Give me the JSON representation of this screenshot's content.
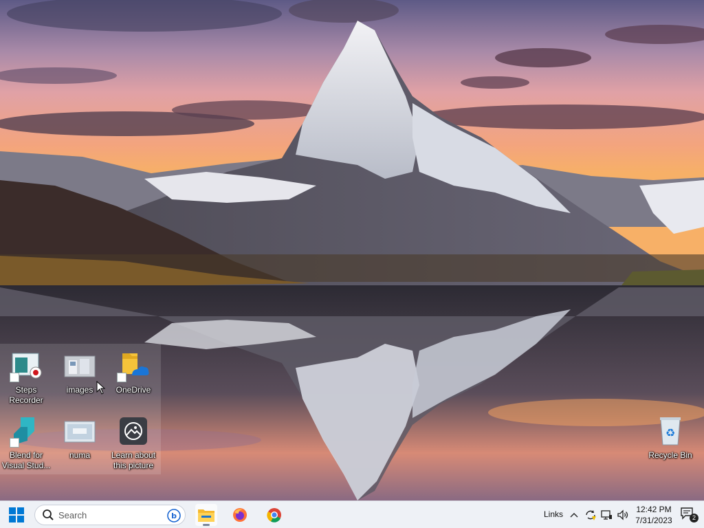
{
  "desktop": {
    "icons": [
      {
        "label": "Steps Recorder",
        "icon": "steps-recorder-icon"
      },
      {
        "label": "images",
        "icon": "image-folder-icon"
      },
      {
        "label": "OneDrive",
        "icon": "onedrive-icon"
      },
      {
        "label": "Blend for Visual Stud...",
        "icon": "blend-icon"
      },
      {
        "label": "numa",
        "icon": "image-file-icon"
      },
      {
        "label": "Learn about this picture",
        "icon": "learn-picture-icon"
      },
      {
        "label": "Recycle Bin",
        "icon": "recycle-bin-icon"
      }
    ]
  },
  "taskbar": {
    "search_placeholder": "Search",
    "apps": [
      {
        "name": "File Explorer",
        "icon": "file-explorer-icon",
        "active": true
      },
      {
        "name": "Firefox",
        "icon": "firefox-icon",
        "active": false
      },
      {
        "name": "Chrome",
        "icon": "chrome-icon",
        "active": false
      }
    ],
    "tray": {
      "links_label": "Links",
      "time": "12:42 PM",
      "date": "7/31/2023",
      "notification_count": "2"
    }
  },
  "colors": {
    "taskbar_bg": "#eef1f6",
    "accent": "#0078d4"
  }
}
